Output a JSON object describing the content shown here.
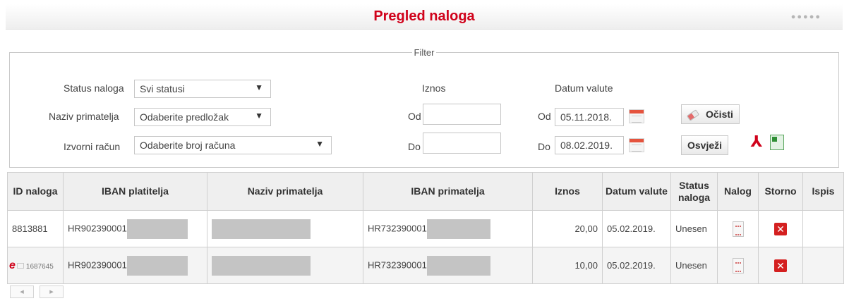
{
  "header": {
    "title": "Pregled naloga",
    "menu_dots": "●●●●●"
  },
  "filter": {
    "legend": "Filter",
    "status": {
      "label": "Status naloga",
      "value": "Svi statusi"
    },
    "recipient": {
      "label": "Naziv primatelja",
      "value": "Odaberite predložak"
    },
    "source_account": {
      "label": "Izvorni račun",
      "value": "Odaberite broj računa"
    },
    "amount": {
      "label": "Iznos",
      "from_label": "Od",
      "to_label": "Do",
      "from_value": "",
      "to_value": ""
    },
    "value_date": {
      "label": "Datum valute",
      "from_label": "Od",
      "to_label": "Do",
      "from_value": "05.11.2018.",
      "to_value": "08.02.2019."
    },
    "clear_label": "Očisti",
    "refresh_label": "Osvježi",
    "dropdown_arrow": "▼"
  },
  "table": {
    "columns": [
      "ID naloga",
      "IBAN platitelja",
      "Naziv primatelja",
      "IBAN primatelja",
      "Iznos",
      "Datum valute",
      "Status naloga",
      "Nalog",
      "Storno",
      "Ispis"
    ],
    "rows": [
      {
        "id": "8813881",
        "iban_payer": "HR902390001",
        "recipient": "",
        "iban_recipient": "HR732390001",
        "amount": "20,00",
        "date": "05.02.2019.",
        "status": "Unesen"
      },
      {
        "id": "1687645",
        "iban_payer": "HR902390001",
        "recipient": "",
        "iban_recipient": "HR732390001",
        "amount": "10,00",
        "date": "05.02.2019.",
        "status": "Unesen"
      }
    ]
  },
  "pager": {
    "prev": "◂",
    "next": "▸"
  },
  "icons": {
    "pdf": "pdf-icon",
    "excel": "excel-icon",
    "calendar": "calendar-icon",
    "eraser": "eraser-icon",
    "document": "document-icon",
    "cancel": "cancel-x-icon",
    "e_invoice": "e-invoice-icon"
  },
  "colors": {
    "title": "#d0021b",
    "cancel": "#d42020"
  }
}
